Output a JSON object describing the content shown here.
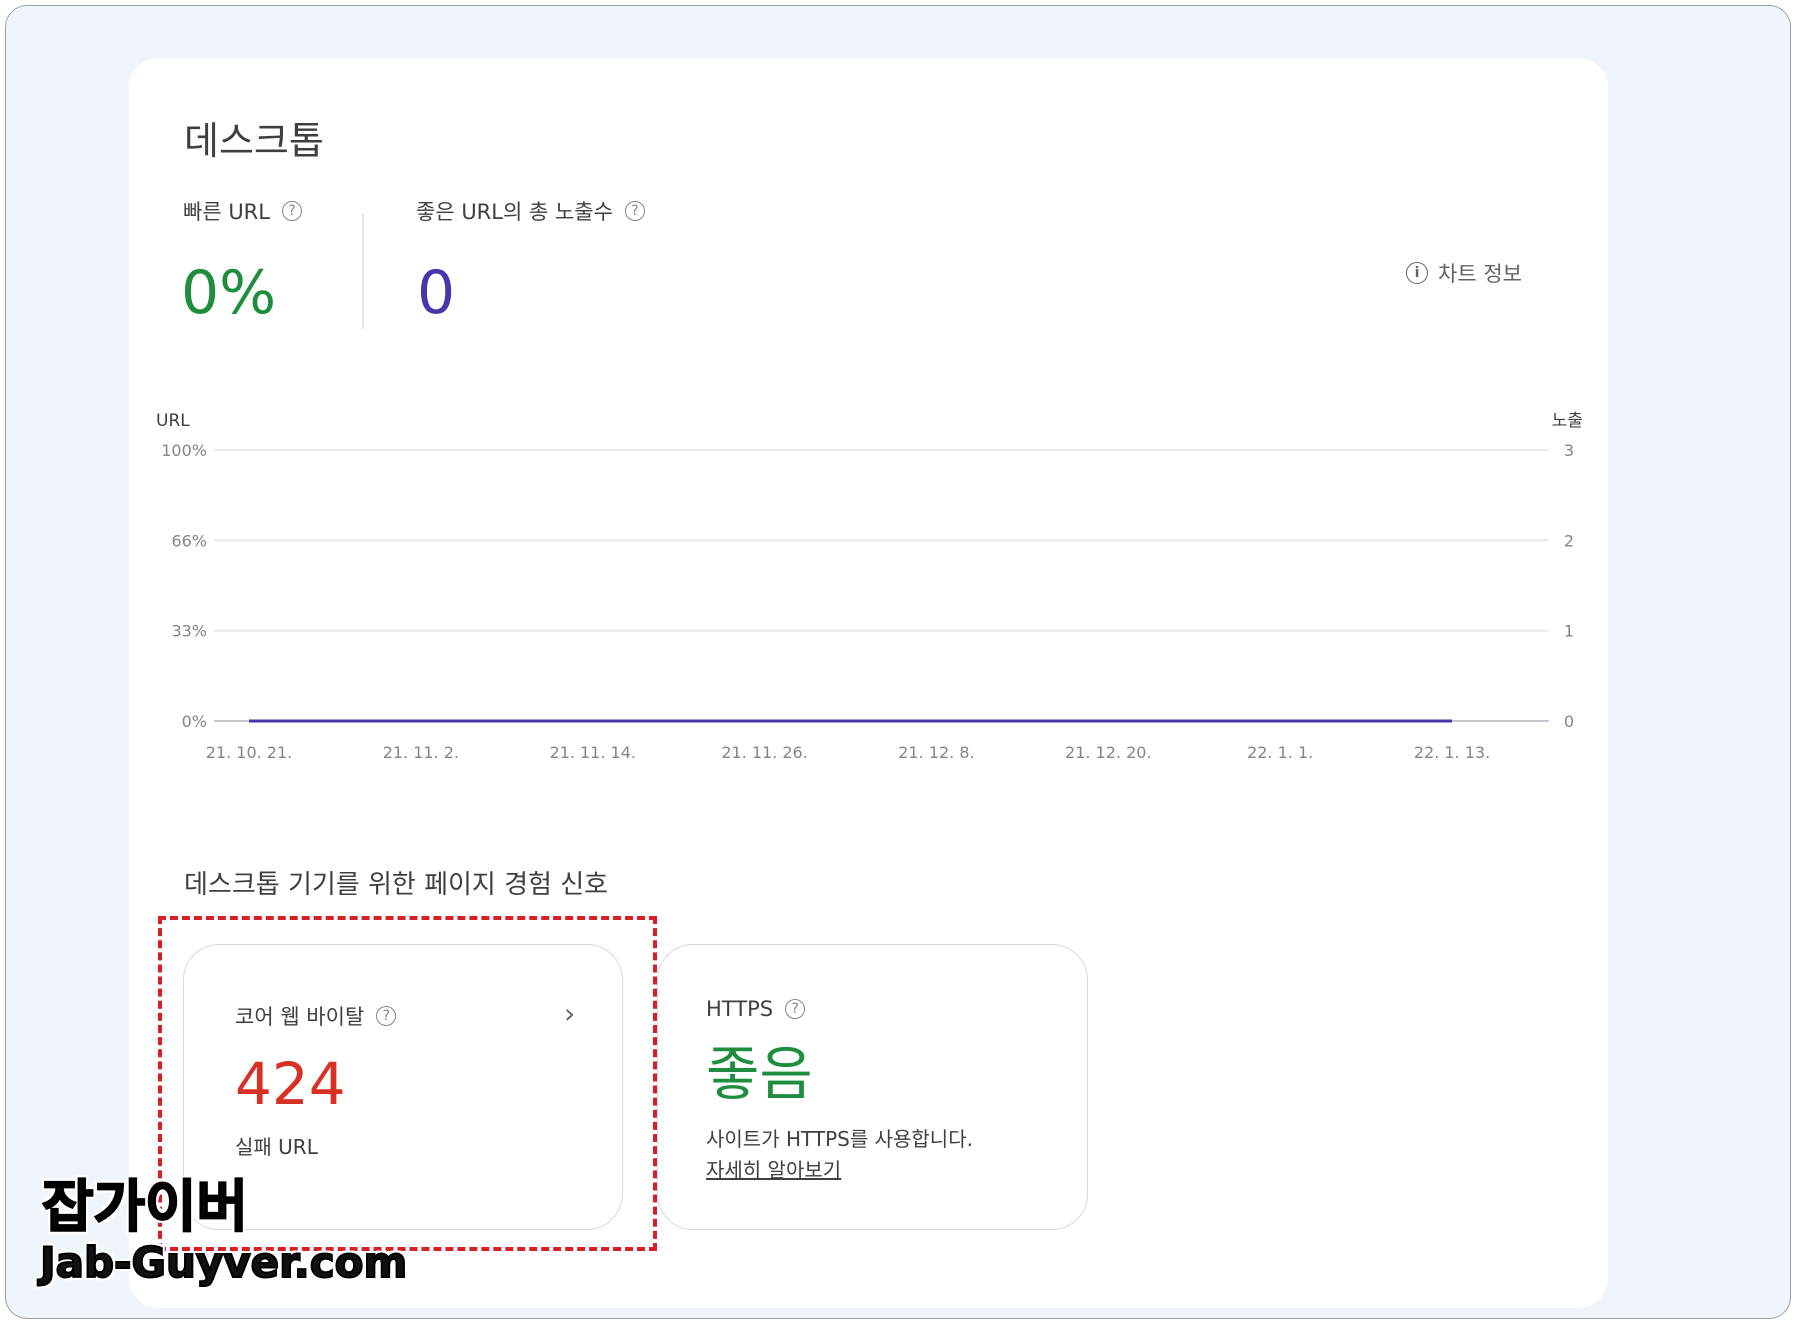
{
  "title": "데스크톱",
  "metrics": {
    "fast_url": {
      "label": "빠른 URL",
      "value": "0%"
    },
    "good_impressions": {
      "label": "좋은 URL의 총 노출수",
      "value": "0"
    }
  },
  "chart_info_label": "차트 정보",
  "icons": {
    "help": "?",
    "info": "i"
  },
  "colors": {
    "green": "#1e8e3e",
    "purple": "#4b35a8",
    "red": "#d93025"
  },
  "chart_data": {
    "type": "line",
    "ylabel_left": "URL",
    "ylabel_right": "노출",
    "left_ticks": [
      "100%",
      "66%",
      "33%",
      "0%"
    ],
    "right_ticks": [
      "3",
      "2",
      "1",
      "0"
    ],
    "x_ticks": [
      "21. 10. 21.",
      "21. 11. 2.",
      "21. 11. 14.",
      "21. 11. 26.",
      "21. 12. 8.",
      "21. 12. 20.",
      "22. 1. 1.",
      "22. 1. 13."
    ],
    "ylim_left": [
      0,
      100
    ],
    "ylim_right": [
      0,
      3
    ],
    "series": [
      {
        "values": [
          0,
          0,
          0,
          0,
          0,
          0,
          0,
          0
        ]
      }
    ]
  },
  "section_title": "데스크톱 기기를 위한 페이지 경험 신호",
  "cwv_card": {
    "label": "코어 웹 바이탈",
    "value": "424",
    "sub": "실패 URL",
    "chevron": "›"
  },
  "https_card": {
    "label": "HTTPS",
    "value": "좋음",
    "desc": "사이트가 HTTPS를 사용합니다.",
    "link": "자세히 알아보기"
  },
  "watermark": {
    "line1": "잡가이버",
    "line2": "Jab-Guyver.com"
  }
}
